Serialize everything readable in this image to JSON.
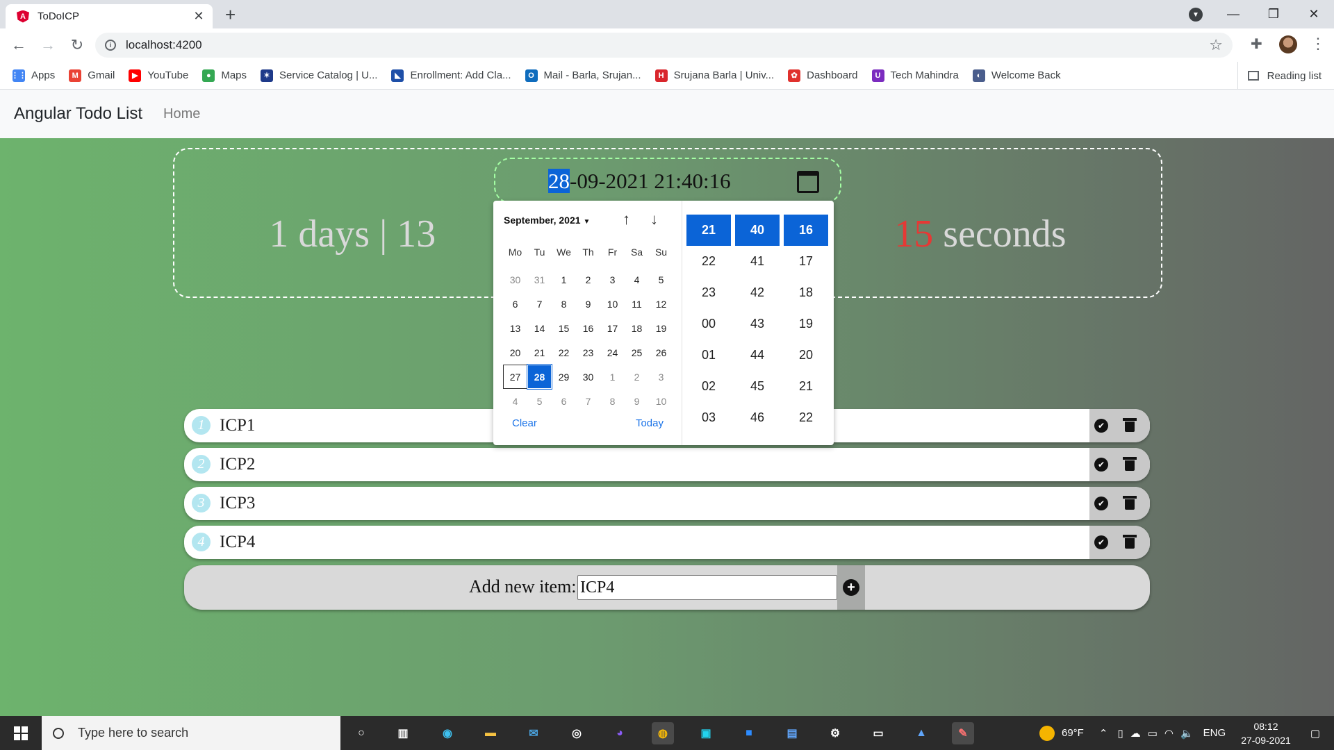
{
  "browser": {
    "tab_title": "ToDoICP",
    "tab_close": "✕",
    "new_tab": "+",
    "url": "localhost:4200",
    "window_controls": [
      "—",
      "❐",
      "✕"
    ]
  },
  "bookmarks": [
    {
      "label": "Apps",
      "icon": "apps-grid-icon",
      "color": "#4285f4",
      "glyph": "⋮⋮"
    },
    {
      "label": "Gmail",
      "icon": "gmail-icon",
      "color": "#ea4335",
      "glyph": "M"
    },
    {
      "label": "YouTube",
      "icon": "youtube-icon",
      "color": "#ff0000",
      "glyph": "▶"
    },
    {
      "label": "Maps",
      "icon": "maps-icon",
      "color": "#34a853",
      "glyph": "●"
    },
    {
      "label": "Service Catalog | U...",
      "icon": "service-catalog-icon",
      "color": "#1e3a8a",
      "glyph": "✶"
    },
    {
      "label": "Enrollment: Add Cla...",
      "icon": "enrollment-icon",
      "color": "#1e4fa8",
      "glyph": "◣"
    },
    {
      "label": "Mail - Barla, Srujan...",
      "icon": "outlook-icon",
      "color": "#0f6cbd",
      "glyph": "O"
    },
    {
      "label": "Srujana Barla | Univ...",
      "icon": "university-icon",
      "color": "#d9262c",
      "glyph": "H"
    },
    {
      "label": "Dashboard",
      "icon": "dashboard-icon",
      "color": "#e0312d",
      "glyph": "✿"
    },
    {
      "label": "Tech Mahindra",
      "icon": "tech-mahindra-icon",
      "color": "#7b2cbf",
      "glyph": "U"
    },
    {
      "label": "Welcome Back",
      "icon": "globe-icon",
      "color": "#4a5d8c",
      "glyph": "◐"
    }
  ],
  "reading_list": "Reading list",
  "app": {
    "brand": "Angular Todo List",
    "nav_home": "Home"
  },
  "countdown": {
    "left": "1 days | 13",
    "red": "15",
    "right": " seconds"
  },
  "date_input": {
    "day": "28",
    "rest": "-09-2021 21:40:16"
  },
  "picker": {
    "month_label": "September, 2021",
    "weekdays": [
      "Mo",
      "Tu",
      "We",
      "Th",
      "Fr",
      "Sa",
      "Su"
    ],
    "days": [
      {
        "d": "30",
        "s": "muted"
      },
      {
        "d": "31",
        "s": "muted"
      },
      {
        "d": "1",
        "s": ""
      },
      {
        "d": "2",
        "s": ""
      },
      {
        "d": "3",
        "s": ""
      },
      {
        "d": "4",
        "s": ""
      },
      {
        "d": "5",
        "s": ""
      },
      {
        "d": "6",
        "s": ""
      },
      {
        "d": "7",
        "s": ""
      },
      {
        "d": "8",
        "s": ""
      },
      {
        "d": "9",
        "s": ""
      },
      {
        "d": "10",
        "s": ""
      },
      {
        "d": "11",
        "s": ""
      },
      {
        "d": "12",
        "s": ""
      },
      {
        "d": "13",
        "s": ""
      },
      {
        "d": "14",
        "s": ""
      },
      {
        "d": "15",
        "s": ""
      },
      {
        "d": "16",
        "s": ""
      },
      {
        "d": "17",
        "s": ""
      },
      {
        "d": "18",
        "s": ""
      },
      {
        "d": "19",
        "s": ""
      },
      {
        "d": "20",
        "s": ""
      },
      {
        "d": "21",
        "s": ""
      },
      {
        "d": "22",
        "s": ""
      },
      {
        "d": "23",
        "s": ""
      },
      {
        "d": "24",
        "s": ""
      },
      {
        "d": "25",
        "s": ""
      },
      {
        "d": "26",
        "s": ""
      },
      {
        "d": "27",
        "s": "today"
      },
      {
        "d": "28",
        "s": "selected"
      },
      {
        "d": "29",
        "s": ""
      },
      {
        "d": "30",
        "s": ""
      },
      {
        "d": "1",
        "s": "muted"
      },
      {
        "d": "2",
        "s": "muted"
      },
      {
        "d": "3",
        "s": "muted"
      },
      {
        "d": "4",
        "s": "muted"
      },
      {
        "d": "5",
        "s": "muted"
      },
      {
        "d": "6",
        "s": "muted"
      },
      {
        "d": "7",
        "s": "muted"
      },
      {
        "d": "8",
        "s": "muted"
      },
      {
        "d": "9",
        "s": "muted"
      },
      {
        "d": "10",
        "s": "muted"
      }
    ],
    "clear": "Clear",
    "today": "Today",
    "hours": [
      "21",
      "22",
      "23",
      "00",
      "01",
      "02",
      "03"
    ],
    "minutes": [
      "40",
      "41",
      "42",
      "43",
      "44",
      "45",
      "46"
    ],
    "seconds": [
      "16",
      "17",
      "18",
      "19",
      "20",
      "21",
      "22"
    ]
  },
  "todos": [
    {
      "num": "1",
      "text": "ICP1"
    },
    {
      "num": "2",
      "text": "ICP2"
    },
    {
      "num": "3",
      "text": "ICP3"
    },
    {
      "num": "4",
      "text": "ICP4"
    }
  ],
  "add_item": {
    "label": "Add new item:",
    "value": "ICP4"
  },
  "taskbar": {
    "search_placeholder": "Type here to search",
    "weather": "69°F",
    "lang": "ENG",
    "time": "08:12",
    "date": "27-09-2021"
  },
  "colors": {
    "accent": "#0b64d7",
    "countdown_red": "#e53935",
    "link": "#1a73e8"
  }
}
